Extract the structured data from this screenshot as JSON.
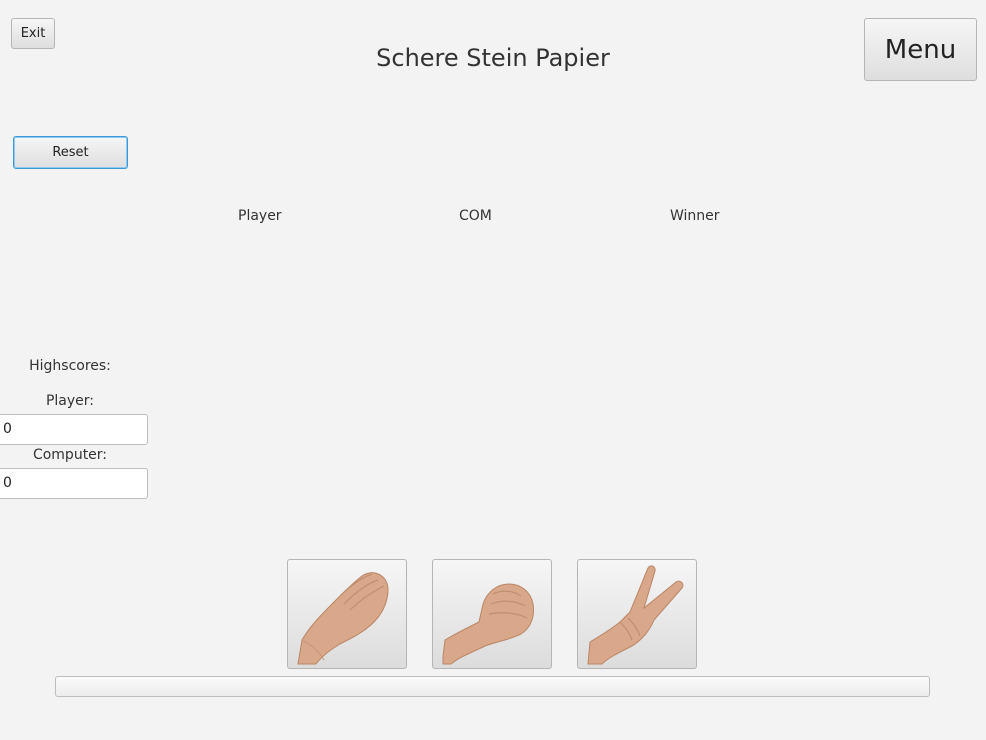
{
  "window": {
    "title": "Schere Stein Papier"
  },
  "toolbar": {
    "exit_label": "Exit",
    "menu_label": "Menu",
    "reset_label": "Reset"
  },
  "columns": {
    "player": "Player",
    "com": "COM",
    "winner": "Winner"
  },
  "highscores": {
    "title": "Highscores:",
    "player_label": "Player:",
    "player_value": "0",
    "computer_label": "Computer:",
    "computer_value": "0"
  },
  "choices": [
    {
      "icon": "paper-hand-icon"
    },
    {
      "icon": "rock-fist-icon"
    },
    {
      "icon": "scissors-hand-icon"
    }
  ],
  "progress": {
    "value": 0
  },
  "colors": {
    "background": "#f3f3f3",
    "focus_border": "#3a9ad9",
    "skin": "#d9a789"
  }
}
